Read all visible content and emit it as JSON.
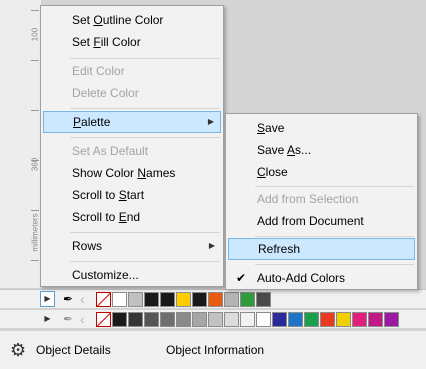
{
  "ruler": {
    "marks": [
      "100",
      "360"
    ],
    "label": "millimeters"
  },
  "main_menu": {
    "items": [
      {
        "label": "Set Outline Color",
        "ul": "O",
        "disabled": false
      },
      {
        "label": "Set Fill Color",
        "ul": "F",
        "disabled": false
      },
      {
        "label": "Edit Color",
        "ul": "",
        "disabled": true
      },
      {
        "label": "Delete Color",
        "ul": "",
        "disabled": true
      },
      {
        "label": "Palette",
        "ul": "P",
        "disabled": false,
        "submenu": true
      },
      {
        "label": "Set As Default",
        "ul": "",
        "disabled": true
      },
      {
        "label": "Show Color Names",
        "ul": "N",
        "disabled": false
      },
      {
        "label": "Scroll to Start",
        "ul": "S",
        "disabled": false
      },
      {
        "label": "Scroll to End",
        "ul": "E",
        "disabled": false
      },
      {
        "label": "Rows",
        "ul": "",
        "disabled": false,
        "submenu": true
      },
      {
        "label": "Customize...",
        "ul": "",
        "disabled": false
      }
    ]
  },
  "sub_menu": {
    "items": [
      {
        "label": "Save",
        "disabled": false
      },
      {
        "label": "Save As...",
        "disabled": false
      },
      {
        "label": "Close",
        "disabled": false
      },
      {
        "label": "Add from Selection",
        "disabled": true
      },
      {
        "label": "Add from Document",
        "disabled": false
      },
      {
        "label": "Refresh",
        "disabled": false,
        "highlighted": true
      },
      {
        "label": "Auto-Add Colors",
        "disabled": false,
        "checked": true
      }
    ]
  },
  "palette_rows": {
    "row1_colors": [
      "#ffffff",
      "#c0c0c0",
      "#1a1a1a",
      "#1a1a1a",
      "#ffcc00",
      "#1a1a1a",
      "#e85a10",
      "#b4b4b4",
      "#2e9c3c",
      "#4a4a4a"
    ],
    "row2_colors": [
      "#1a1a1a",
      "#363636",
      "#555555",
      "#6e6e6e",
      "#8a8a8a",
      "#a6a6a6",
      "#c2c2c2",
      "#dcdcdc",
      "#f2f2f2",
      "#ffffff",
      "#2a2a9a",
      "#1e74c4",
      "#1aa04a",
      "#e83a20",
      "#f0d000",
      "#e0207a",
      "#c01a86",
      "#9c1aa0"
    ]
  },
  "status_bar": {
    "object_details": "Object Details",
    "object_information": "Object Information"
  }
}
